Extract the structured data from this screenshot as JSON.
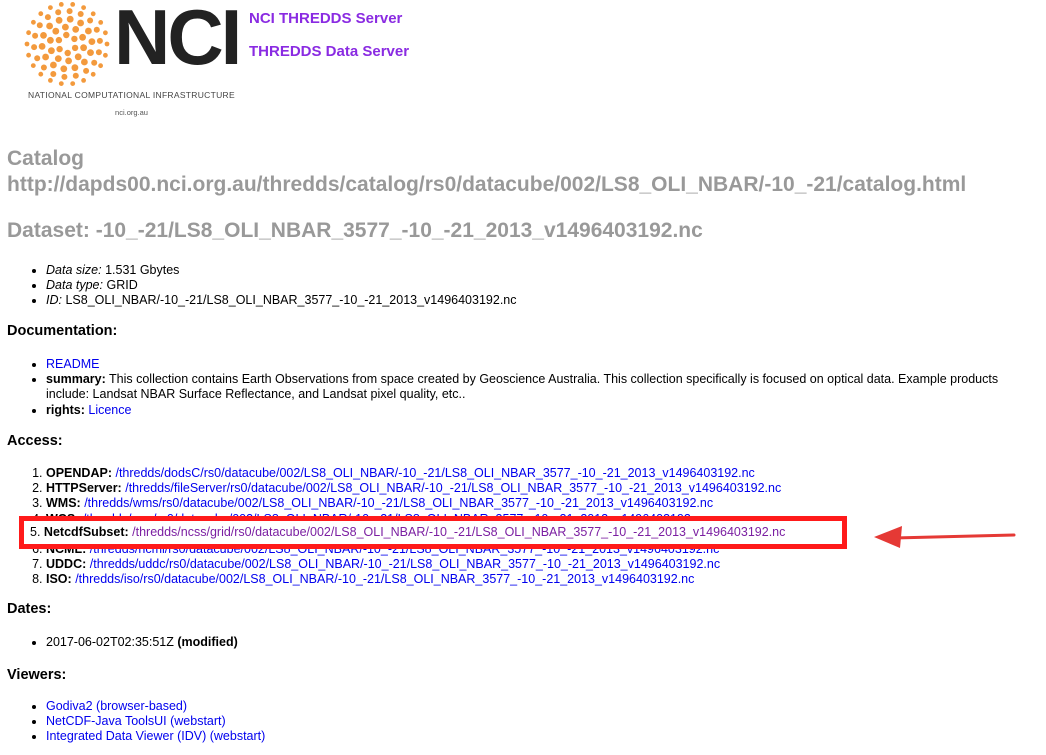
{
  "header": {
    "logo_text": "NCI",
    "logo_subtitle": "NATIONAL COMPUTATIONAL INFRASTRUCTURE",
    "logo_url": "nci.org.au",
    "server_link": "NCI THREDDS Server",
    "tds_link": "THREDDS Data Server"
  },
  "catalog": {
    "label": "Catalog",
    "url": "http://dapds00.nci.org.au/thredds/catalog/rs0/datacube/002/LS8_OLI_NBAR/-10_-21/catalog.html"
  },
  "dataset_title": "Dataset: -10_-21/LS8_OLI_NBAR_3577_-10_-21_2013_v1496403192.nc",
  "info": [
    {
      "label": "Data size:",
      "value": "1.531 Gbytes"
    },
    {
      "label": "Data type:",
      "value": "GRID"
    },
    {
      "label": "ID:",
      "value": "LS8_OLI_NBAR/-10_-21/LS8_OLI_NBAR_3577_-10_-21_2013_v1496403192.nc"
    }
  ],
  "documentation": {
    "heading": "Documentation:",
    "readme": "README",
    "summary_label": "summary:",
    "summary_text": "This collection contains Earth Observations from space created by Geoscience Australia. This collection specifically is focused on optical data. Example products include: Landsat NBAR Surface Reflectance, and Landsat pixel quality, etc..",
    "rights_label": "rights:",
    "rights_link": "Licence"
  },
  "access": {
    "heading": "Access:",
    "items": [
      {
        "service": "OPENDAP:",
        "url": "/thredds/dodsC/rs0/datacube/002/LS8_OLI_NBAR/-10_-21/LS8_OLI_NBAR_3577_-10_-21_2013_v1496403192.nc"
      },
      {
        "service": "HTTPServer:",
        "url": "/thredds/fileServer/rs0/datacube/002/LS8_OLI_NBAR/-10_-21/LS8_OLI_NBAR_3577_-10_-21_2013_v1496403192.nc"
      },
      {
        "service": "WMS:",
        "url": "/thredds/wms/rs0/datacube/002/LS8_OLI_NBAR/-10_-21/LS8_OLI_NBAR_3577_-10_-21_2013_v1496403192.nc"
      },
      {
        "service": "WCS:",
        "url": "/thredds/wcs/rs0/datacube/002/LS8_OLI_NBAR/-10_-21/LS8_OLI_NBAR_3577_-10_-21_2013_v1496403192.nc"
      },
      {
        "service": "NetcdfSubset:",
        "url": "/thredds/ncss/grid/rs0/datacube/002/LS8_OLI_NBAR/-10_-21/LS8_OLI_NBAR_3577_-10_-21_2013_v1496403192.nc"
      },
      {
        "service": "NCML:",
        "url": "/thredds/ncml/rs0/datacube/002/LS8_OLI_NBAR/-10_-21/LS8_OLI_NBAR_3577_-10_-21_2013_v1496403192.nc"
      },
      {
        "service": "UDDC:",
        "url": "/thredds/uddc/rs0/datacube/002/LS8_OLI_NBAR/-10_-21/LS8_OLI_NBAR_3577_-10_-21_2013_v1496403192.nc"
      },
      {
        "service": "ISO:",
        "url": "/thredds/iso/rs0/datacube/002/LS8_OLI_NBAR/-10_-21/LS8_OLI_NBAR_3577_-10_-21_2013_v1496403192.nc"
      }
    ],
    "highlight_number": "5."
  },
  "dates": {
    "heading": "Dates:",
    "value": "2017-06-02T02:35:51Z",
    "type": "(modified)"
  },
  "viewers": {
    "heading": "Viewers:",
    "items": [
      "Godiva2 (browser-based)",
      "NetCDF-Java ToolsUI (webstart)",
      "Integrated Data Viewer (IDV) (webstart)"
    ]
  },
  "colors": {
    "highlight_border": "#ff1a1a",
    "heading_gray": "#999999",
    "visited_link": "#7b1fa2",
    "link": "#0000ee"
  }
}
